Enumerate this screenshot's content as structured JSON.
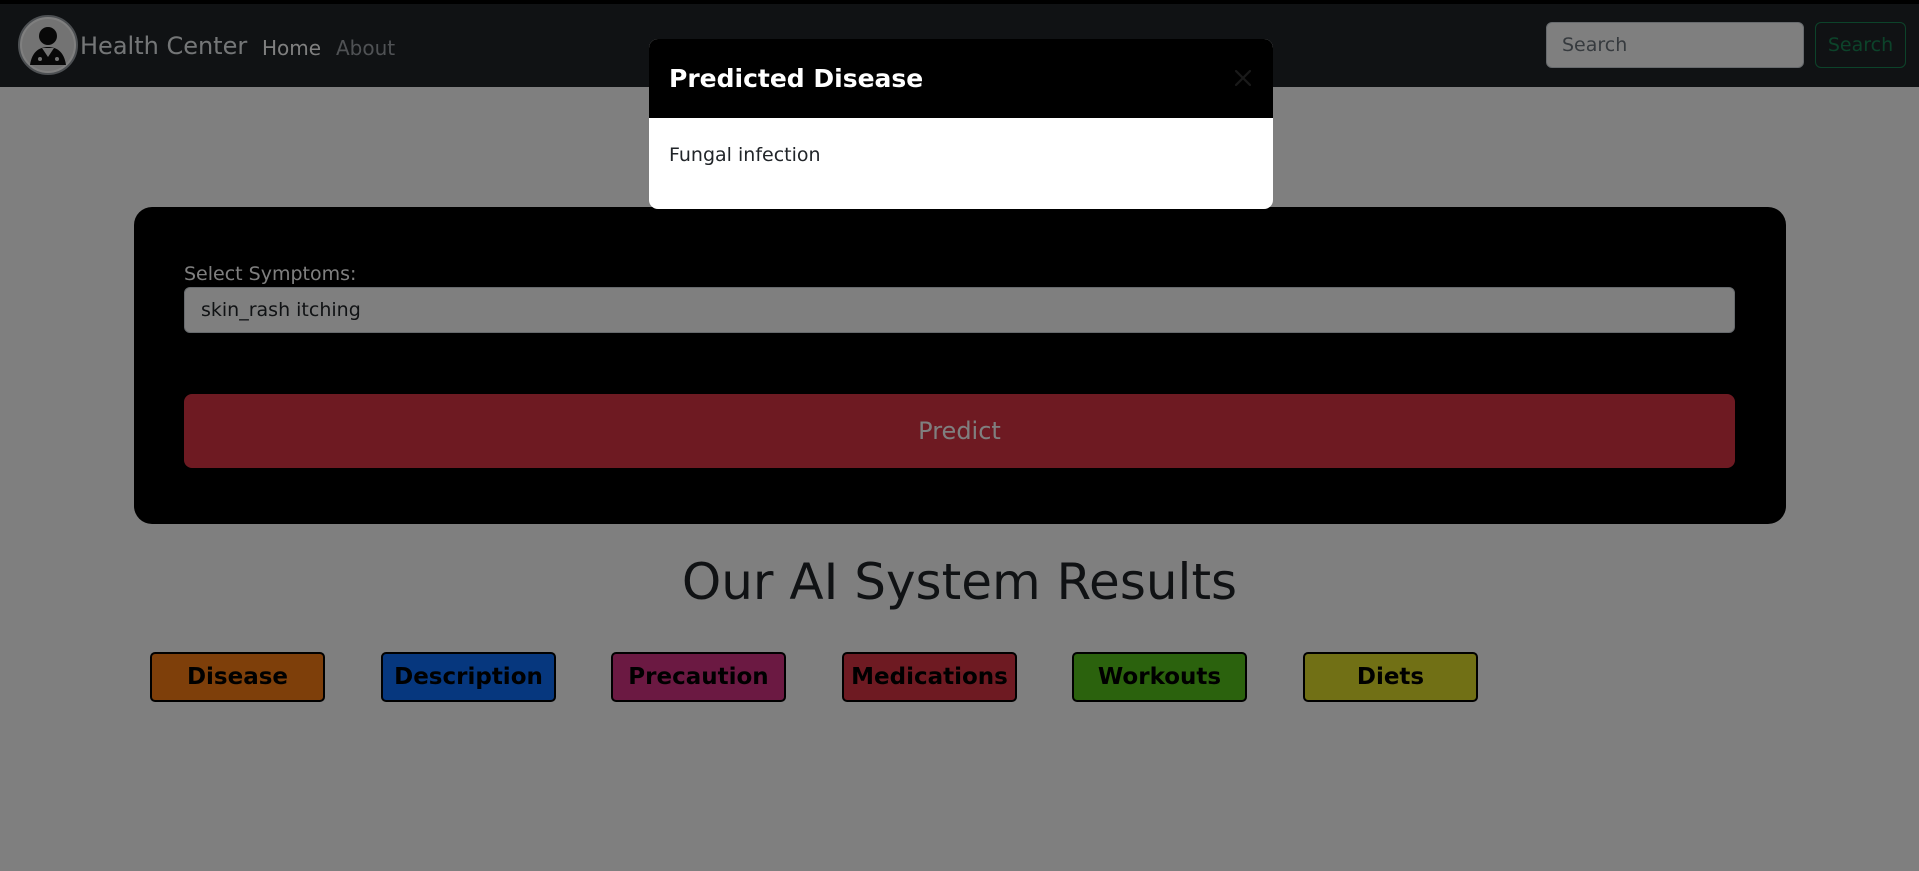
{
  "navbar": {
    "brand": "Health Center",
    "links": [
      "Home",
      "About"
    ],
    "search_placeholder": "Search",
    "search_button": "Search"
  },
  "form": {
    "symptoms_label": "Select Symptoms:",
    "symptoms_value": "skin_rash itching",
    "predict_button": "Predict"
  },
  "results": {
    "title": "Our AI System Results",
    "buttons": [
      {
        "label": "Disease",
        "color": "#fd7e14"
      },
      {
        "label": "Description",
        "color": "#0d6efd"
      },
      {
        "label": "Precaution",
        "color": "#d63384"
      },
      {
        "label": "Medications",
        "color": "#dc3545"
      },
      {
        "label": "Workouts",
        "color": "#57c41b"
      },
      {
        "label": "Diets",
        "color": "#e2e02b"
      }
    ]
  },
  "modal": {
    "title": "Predicted Disease",
    "body": "Fungal infection"
  },
  "icons": {
    "brand_logo": "doctor-avatar-icon",
    "close": "close-icon"
  }
}
